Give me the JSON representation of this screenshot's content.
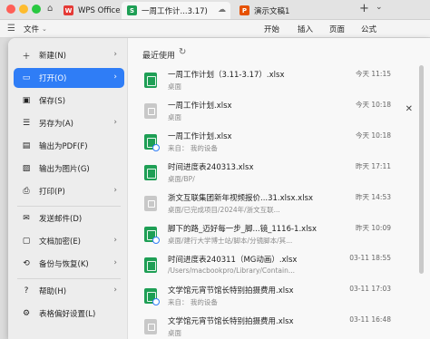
{
  "titlebar": {
    "tabs": [
      {
        "label": "WPS Office",
        "logo": "W",
        "color": "#e53935"
      },
      {
        "label": "一周工作计...3.17)",
        "logo": "S",
        "color": "#1e9f55"
      },
      {
        "label": "演示文稿1",
        "logo": "P",
        "color": "#e65100"
      }
    ],
    "home_icon": "home-icon",
    "add_tab": "+",
    "dropdown": "⌄"
  },
  "menubar": {
    "file_menu": "文件",
    "items": [
      "开始",
      "插入",
      "页面",
      "公式"
    ]
  },
  "sidebar": {
    "items": [
      {
        "label": "新建(N)",
        "icon": "new-icon",
        "arrow": true
      },
      {
        "label": "打开(O)",
        "icon": "open-folder-icon",
        "arrow": true,
        "active": true
      },
      {
        "label": "保存(S)",
        "icon": "save-icon",
        "arrow": false
      },
      {
        "label": "另存为(A)",
        "icon": "save-as-icon",
        "arrow": true
      },
      {
        "label": "输出为PDF(F)",
        "icon": "pdf-icon",
        "arrow": false
      },
      {
        "label": "输出为图片(G)",
        "icon": "image-icon",
        "arrow": false
      },
      {
        "label": "打印(P)",
        "icon": "print-icon",
        "arrow": true
      },
      {
        "label": "发送邮件(D)",
        "icon": "mail-icon",
        "arrow": false
      },
      {
        "label": "文档加密(E)",
        "icon": "lock-icon",
        "arrow": true
      },
      {
        "label": "备份与恢复(K)",
        "icon": "backup-icon",
        "arrow": true
      },
      {
        "label": "帮助(H)",
        "icon": "help-icon",
        "arrow": true
      },
      {
        "label": "表格偏好设置(L)",
        "icon": "settings-icon",
        "arrow": false
      }
    ]
  },
  "recent": {
    "title": "最近使用",
    "refresh_icon": "refresh-icon",
    "files": [
      {
        "name": "一周工作计划（3.11-3.17）.xlsx",
        "path": "桌面",
        "time": "今天 11:15",
        "type": "xlsx",
        "cloud": false,
        "close": false
      },
      {
        "name": "一周工作计划.xlsx",
        "path": "桌面",
        "time": "今天 10:18",
        "type": "gray",
        "cloud": false,
        "close": true
      },
      {
        "name": "一周工作计划.xlsx",
        "path": "来自：  我的设备",
        "time": "今天 10:18",
        "type": "xlsx",
        "cloud": true,
        "close": false
      },
      {
        "name": "时间进度表240313.xlsx",
        "path": "桌面/BP/",
        "time": "昨天 17:11",
        "type": "xlsx",
        "cloud": false,
        "close": false
      },
      {
        "name": "浙文互联集团新年视频报价...31.xlsx.xlsx",
        "path": "桌面/已完成项目/2024年/浙文互联...",
        "time": "昨天 14:53",
        "type": "gray",
        "cloud": false,
        "close": false
      },
      {
        "name": "脚下的路_迈好每一步_脚...镜_1116-1.xlsx",
        "path": "桌面/建行大学博士站/脚本/分镜脚本/其...",
        "time": "昨天 10:09",
        "type": "xlsx",
        "cloud": true,
        "close": false
      },
      {
        "name": "时间进度表240311（MG动画）.xlsx",
        "path": "/Users/macbookpro/Library/Contain...",
        "time": "03-11 18:55",
        "type": "xlsx",
        "cloud": false,
        "close": false
      },
      {
        "name": "文学馆元宵节馆长特别拍摄费用.xlsx",
        "path": "来自：  我的设备",
        "time": "03-11 17:03",
        "type": "xlsx",
        "cloud": true,
        "close": false
      },
      {
        "name": "文学馆元宵节馆长特别拍摄费用.xlsx",
        "path": "桌面",
        "time": "03-11 16:48",
        "type": "gray",
        "cloud": false,
        "close": false
      }
    ]
  },
  "colors": {
    "accent": "#2f7df6",
    "xlsx": "#1e9f55",
    "traffic_red": "#ff5f57",
    "traffic_yellow": "#febc2e",
    "traffic_green": "#28c840"
  }
}
